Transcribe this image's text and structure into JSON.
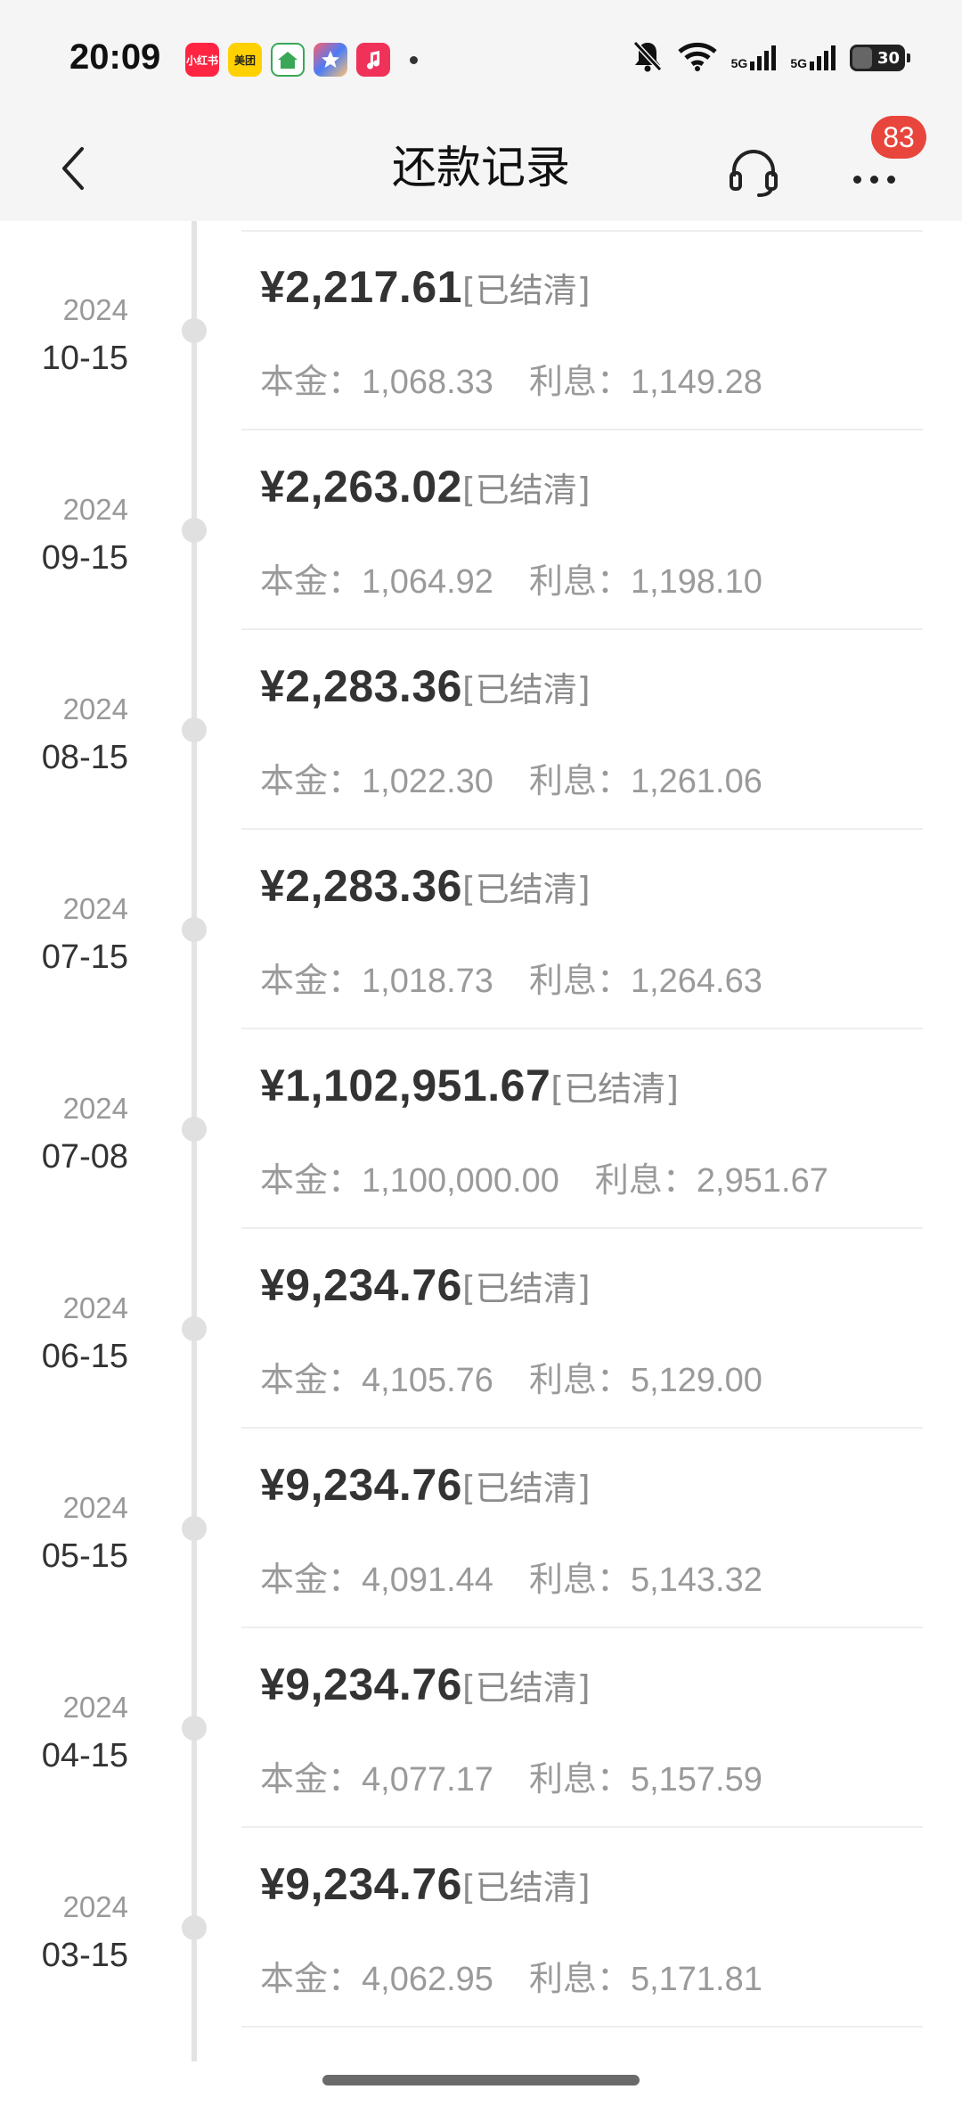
{
  "status_bar": {
    "time": "20:09",
    "apps": [
      {
        "name": "xiaohongshu",
        "label": "小红书",
        "color": "#ff2442"
      },
      {
        "name": "meituan",
        "label": "美团",
        "color": "#ffd100"
      },
      {
        "name": "home-app",
        "label": "",
        "color": "#3aa757"
      },
      {
        "name": "star-app",
        "label": "",
        "color": "#4a7cf7"
      },
      {
        "name": "music-app",
        "label": "",
        "color": "#f0325a"
      }
    ],
    "network_1": "5G",
    "network_2": "5G",
    "battery": "30"
  },
  "nav": {
    "title": "还款记录",
    "badge": "83"
  },
  "records": [
    {
      "year": "2024",
      "date": "10-15",
      "amount": "¥2,217.61",
      "status": "[已结清]",
      "principal_label": "本金：",
      "principal": "1,068.33",
      "interest_label": "利息：",
      "interest": "1,149.28"
    },
    {
      "year": "2024",
      "date": "09-15",
      "amount": "¥2,263.02",
      "status": "[已结清]",
      "principal_label": "本金：",
      "principal": "1,064.92",
      "interest_label": "利息：",
      "interest": "1,198.10"
    },
    {
      "year": "2024",
      "date": "08-15",
      "amount": "¥2,283.36",
      "status": "[已结清]",
      "principal_label": "本金：",
      "principal": "1,022.30",
      "interest_label": "利息：",
      "interest": "1,261.06"
    },
    {
      "year": "2024",
      "date": "07-15",
      "amount": "¥2,283.36",
      "status": "[已结清]",
      "principal_label": "本金：",
      "principal": "1,018.73",
      "interest_label": "利息：",
      "interest": "1,264.63"
    },
    {
      "year": "2024",
      "date": "07-08",
      "amount": "¥1,102,951.67",
      "status": "[已结清]",
      "principal_label": "本金：",
      "principal": "1,100,000.00",
      "interest_label": "利息：",
      "interest": "2,951.67"
    },
    {
      "year": "2024",
      "date": "06-15",
      "amount": "¥9,234.76",
      "status": "[已结清]",
      "principal_label": "本金：",
      "principal": "4,105.76",
      "interest_label": "利息：",
      "interest": "5,129.00"
    },
    {
      "year": "2024",
      "date": "05-15",
      "amount": "¥9,234.76",
      "status": "[已结清]",
      "principal_label": "本金：",
      "principal": "4,091.44",
      "interest_label": "利息：",
      "interest": "5,143.32"
    },
    {
      "year": "2024",
      "date": "04-15",
      "amount": "¥9,234.76",
      "status": "[已结清]",
      "principal_label": "本金：",
      "principal": "4,077.17",
      "interest_label": "利息：",
      "interest": "5,157.59"
    },
    {
      "year": "2024",
      "date": "03-15",
      "amount": "¥9,234.76",
      "status": "[已结清]",
      "principal_label": "本金：",
      "principal": "4,062.95",
      "interest_label": "利息：",
      "interest": "5,171.81"
    }
  ]
}
